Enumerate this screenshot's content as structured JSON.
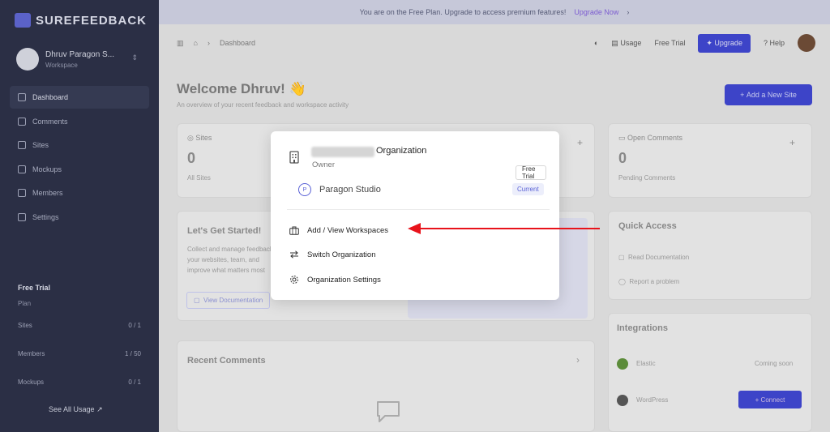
{
  "sidebar": {
    "logo_text": "SUREFEEDBACK",
    "account": {
      "name": "Dhruv Paragon S...",
      "sub": "Workspace"
    },
    "nav": [
      {
        "label": "Dashboard",
        "active": true
      },
      {
        "label": "Comments"
      },
      {
        "label": "Sites"
      },
      {
        "label": "Mockups"
      },
      {
        "label": "Members"
      },
      {
        "label": "Settings"
      }
    ],
    "plan": {
      "title": "Free Trial",
      "sub": "Plan",
      "rows": [
        {
          "label": "Sites",
          "value": "0 / 1"
        },
        {
          "label": "Members",
          "value": "1 / 50"
        },
        {
          "label": "Mockups",
          "value": "0 / 1"
        }
      ],
      "usage_link": "See All Usage"
    }
  },
  "banner": {
    "text": "You are on the Free Plan. Upgrade to access premium features!",
    "link": "Upgrade Now"
  },
  "topbar": {
    "breadcrumb": "Dashboard",
    "usage": "Usage",
    "trial": "Free Trial",
    "upgrade": "Upgrade",
    "help": "Help"
  },
  "main": {
    "welcome": "Welcome Dhruv! 👋",
    "welcome_sub": "An overview of your recent feedback and workspace activity",
    "add_site": "Add a New Site",
    "sites_card": {
      "label": "Sites",
      "count": "0",
      "sub": "All Sites"
    },
    "comments_card": {
      "label": "Open Comments",
      "count": "0",
      "sub": "Pending Comments"
    },
    "getting_started": {
      "title": "Let's Get Started!",
      "lines": [
        "Collect and manage feedback",
        "your websites, team, and",
        "improve what matters most"
      ],
      "button": "View Documentation"
    },
    "quick_access": {
      "title": "Quick Access",
      "items": [
        "Read Documentation",
        "Report a problem"
      ]
    },
    "integrations": {
      "title": "Integrations",
      "items": [
        {
          "name": "Elastic",
          "action": "Coming soon"
        },
        {
          "name": "WordPress",
          "action": "Connect"
        }
      ]
    },
    "recent_comments": {
      "title": "Recent Comments"
    }
  },
  "modal": {
    "org_suffix": "Organization",
    "role": "Owner",
    "trial_badge": "Free Trial",
    "workspace": {
      "initial": "P",
      "name": "Paragon Studio",
      "badge": "Current"
    },
    "menu": [
      {
        "label": "Add / View Workspaces",
        "icon": "briefcase-icon"
      },
      {
        "label": "Switch Organization",
        "icon": "switch-arrows-icon"
      },
      {
        "label": "Organization Settings",
        "icon": "gear-icon"
      }
    ]
  },
  "colors": {
    "accent": "#3d44c8",
    "arrow": "#e8131b",
    "sidebar": "#2b2f45"
  }
}
